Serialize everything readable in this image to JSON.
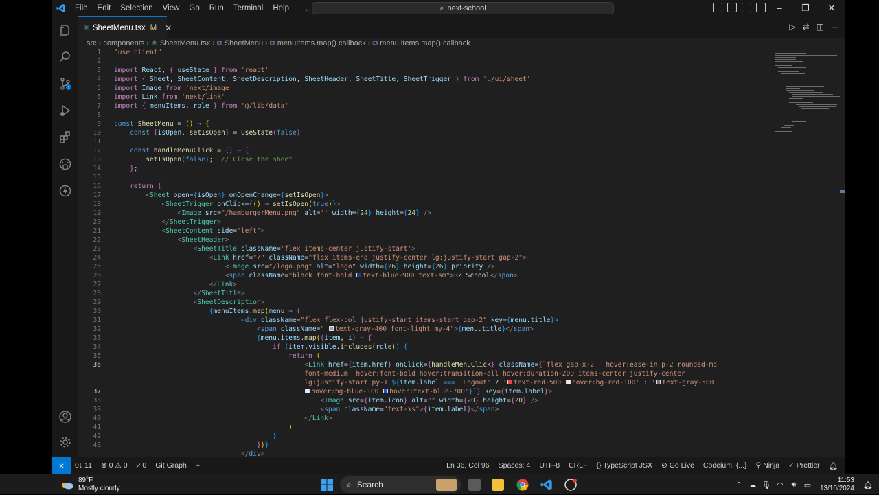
{
  "titlebar": {
    "menu": [
      "File",
      "Edit",
      "Selection",
      "View",
      "Go",
      "Run",
      "Terminal",
      "Help"
    ],
    "search": "next-school",
    "window_buttons": [
      "–",
      "❐",
      "✕"
    ]
  },
  "tab": {
    "name": "SheetMenu.tsx",
    "modified": "M",
    "close": "✕"
  },
  "breadcrumb": [
    "src",
    "components",
    "SheetMenu.tsx",
    "SheetMenu",
    "menuItems.map() callback",
    "menu.items.map() callback"
  ],
  "editor": {
    "active_line": "36",
    "line_numbers": [
      "1",
      "2",
      "3",
      "4",
      "5",
      "6",
      "7",
      "8",
      "9",
      "10",
      "11",
      "12",
      "13",
      "14",
      "15",
      "16",
      "17",
      "18",
      "19",
      "20",
      "21",
      "22",
      "23",
      "24",
      "25",
      "26",
      "27",
      "28",
      "29",
      "30",
      "31",
      "32",
      "33",
      "34",
      "35",
      "36",
      "",
      "",
      "37",
      "38",
      "39",
      "40",
      "41",
      "42",
      "43"
    ]
  },
  "statusbar": {
    "sync": "0↓ 11",
    "problems": "⊗ 0 ⚠ 0",
    "ports": "⩗ 0",
    "git_graph": "Git Graph",
    "position": "Ln 36, Col 96",
    "spaces": "Spaces: 4",
    "encoding": "UTF-8",
    "eol": "CRLF",
    "language": "{} TypeScript JSX",
    "golive": "⊘ Go Live",
    "codeium": "Codeium: {...}",
    "ninja": "⚲ Ninja",
    "prettier": "✓ Prettier"
  },
  "taskbar": {
    "temp": "89°F",
    "weather": "Mostly cloudy",
    "search": "Search",
    "time": "11:53",
    "date": "13/10/2024"
  },
  "colors": {
    "accent": "#0078d4",
    "editor_bg": "#1f1f1f",
    "chrome_bg": "#181818"
  }
}
